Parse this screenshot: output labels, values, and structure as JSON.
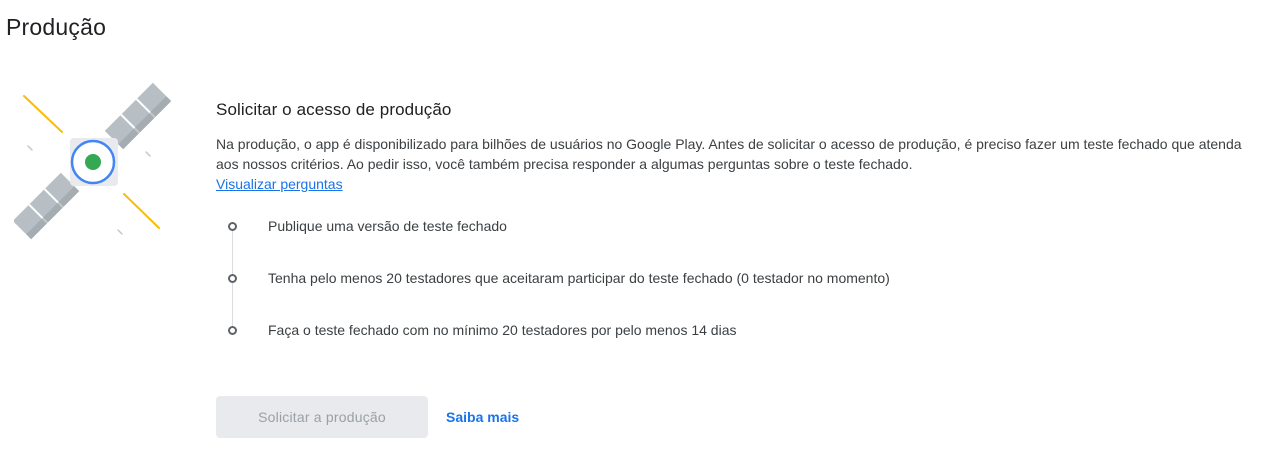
{
  "page": {
    "title": "Produção"
  },
  "illustration": {
    "icon": "satellite-icon",
    "colors": {
      "panel": "#b8bfc4",
      "panel_shade": "#9aa1a7",
      "ring": "#4285f4",
      "core": "#34a853",
      "beam": "#fbbc04"
    }
  },
  "section": {
    "heading": "Solicitar o acesso de produção",
    "description": "Na produção, o app é disponibilizado para bilhões de usuários no Google Play. Antes de solicitar o acesso de produção, é preciso fazer um teste fechado que atenda aos nossos critérios. Ao pedir isso, você também precisa responder a algumas perguntas sobre o teste fechado.",
    "link_label": "Visualizar perguntas"
  },
  "requirements": [
    {
      "label": "Publique uma versão de teste fechado"
    },
    {
      "label": "Tenha pelo menos 20 testadores que aceitaram participar do teste fechado (0 testador no momento)"
    },
    {
      "label": "Faça o teste fechado com no mínimo 20 testadores por pelo menos 14 dias"
    }
  ],
  "actions": {
    "request_label": "Solicitar a produção",
    "learn_more_label": "Saiba mais"
  },
  "theme": {
    "link_color": "#1a73e8",
    "disabled_bg": "#e8eaed",
    "disabled_text": "#9aa0a6"
  }
}
